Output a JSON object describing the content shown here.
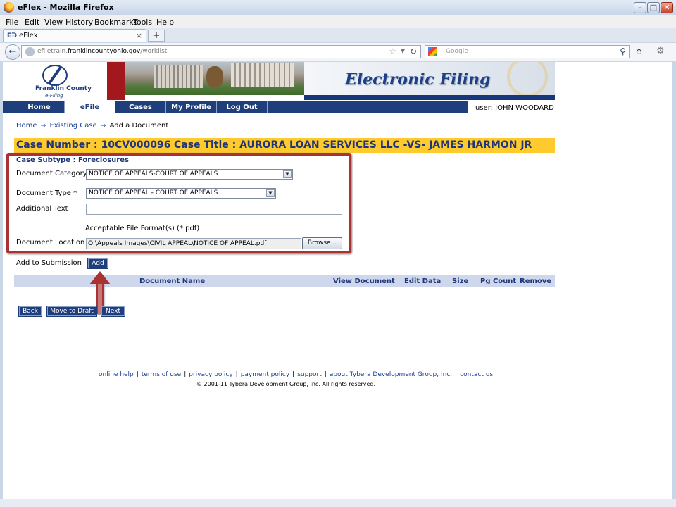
{
  "window": {
    "title": "eFlex - Mozilla Firefox",
    "minimize": "–",
    "maximize": "□",
    "close": "✕"
  },
  "menu": [
    "File",
    "Edit",
    "View",
    "History",
    "Bookmarks",
    "Tools",
    "Help"
  ],
  "browser_tab": {
    "icon": "E∋",
    "label": "eFlex",
    "close": "×",
    "new_tab": "+"
  },
  "address": {
    "url_prefix": "efiletrain.",
    "url_domain": "franklincountyohio.gov",
    "url_path": "/worklist",
    "search_placeholder": "Google"
  },
  "site": {
    "logo_line1": "Franklin County",
    "logo_line2": "e-Filing",
    "banner_title": "Electronic Filing"
  },
  "nav": [
    "Home",
    "eFile",
    "Cases",
    "My Profile",
    "Log Out"
  ],
  "nav_active": "eFile",
  "user": "user: JOHN WOODARD",
  "breadcrumb": {
    "home": "Home",
    "sep": "⇒",
    "existing_case": "Existing Case",
    "current": "Add a Document"
  },
  "case": {
    "number": "Case Number : 10CV000096",
    "title": "Case Title : AURORA LOAN SERVICES LLC -VS- JAMES HARMON JR"
  },
  "form": {
    "subtype": "Case Subtype : Foreclosures",
    "category_label": "Document Category",
    "category_value": "NOTICE OF APPEALS-COURT OF APPEALS",
    "type_label": "Document Type *",
    "type_value": "NOTICE OF APPEAL - COURT OF APPEALS",
    "additional_text_label": "Additional Text",
    "additional_text_value": "",
    "formats": "Acceptable File Format(s) (*.pdf)",
    "location_label": "Document Location",
    "location_value": "O:\\Appeals Images\\CIVIL APPEAL\\NOTICE OF APPEAL.pdf",
    "browse": "Browse...",
    "add_label": "Add to Submission",
    "add_button": "Add"
  },
  "table": {
    "headers": [
      "Document Name",
      "View Document",
      "Edit Data",
      "Size",
      "Pg Count",
      "Remove"
    ]
  },
  "buttons": {
    "back": "Back",
    "draft": "Move to Draft",
    "next": "Next"
  },
  "footer": {
    "links": [
      "online help",
      "terms of use",
      "privacy policy",
      "payment policy",
      "support",
      "about Tybera Development Group, Inc.",
      "contact us"
    ],
    "copyright": "© 2001-11 Tybera Development Group, Inc. All rights reserved."
  },
  "colors": {
    "navy": "#1f3e7c",
    "case_bar": "#ffca2e",
    "highlight": "#a93232",
    "table_header": "#cfd7ec"
  }
}
